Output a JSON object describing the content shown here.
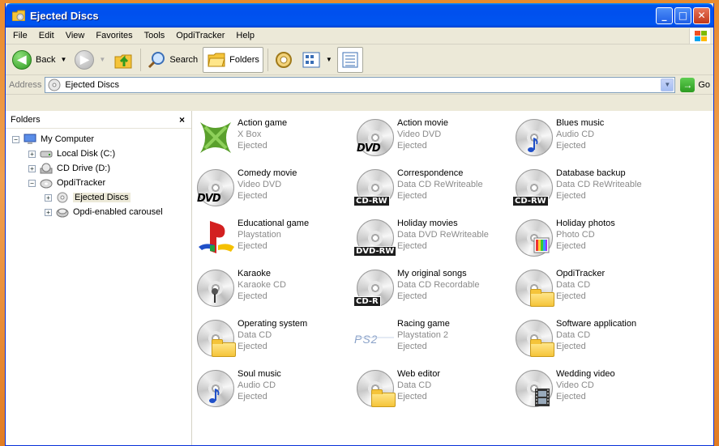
{
  "window": {
    "title": "Ejected Discs"
  },
  "menu": [
    "File",
    "Edit",
    "View",
    "Favorites",
    "Tools",
    "OpdiTracker",
    "Help"
  ],
  "toolbar": {
    "back_label": "Back",
    "search_label": "Search",
    "folders_label": "Folders"
  },
  "address": {
    "label": "Address",
    "value": "Ejected Discs",
    "go_label": "Go"
  },
  "folders_pane": {
    "title": "Folders",
    "close": "×",
    "tree": [
      {
        "label": "My Computer",
        "expander": "−",
        "level": 0,
        "icon": "computer-icon"
      },
      {
        "label": "Local Disk (C:)",
        "expander": "+",
        "level": 1,
        "icon": "hard-disk-icon"
      },
      {
        "label": "CD Drive (D:)",
        "expander": "+",
        "level": 1,
        "icon": "cd-drive-icon"
      },
      {
        "label": "OpdiTracker",
        "expander": "−",
        "level": 1,
        "icon": "disc-tracker-icon"
      },
      {
        "label": "Ejected Discs",
        "expander": "+",
        "level": 2,
        "icon": "ejected-disc-icon",
        "selected": true
      },
      {
        "label": "Opdi-enabled carousel",
        "expander": "+",
        "level": 2,
        "icon": "carousel-icon"
      }
    ]
  },
  "items": [
    {
      "name": "Action game",
      "type": "X Box",
      "status": "Ejected",
      "icon": "xbox-icon"
    },
    {
      "name": "Action movie",
      "type": "Video DVD",
      "status": "Ejected",
      "icon": "dvd-disc-icon",
      "badge": "DVD"
    },
    {
      "name": "Blues music",
      "type": "Audio CD",
      "status": "Ejected",
      "icon": "audio-cd-icon"
    },
    {
      "name": "Comedy movie",
      "type": "Video DVD",
      "status": "Ejected",
      "icon": "dvd-disc-icon",
      "badge": "DVD"
    },
    {
      "name": "Correspondence",
      "type": "Data CD ReWriteable",
      "status": "Ejected",
      "icon": "cd-rw-icon",
      "badge": "CD-RW"
    },
    {
      "name": "Database backup",
      "type": "Data CD ReWriteable",
      "status": "Ejected",
      "icon": "cd-rw-icon",
      "badge": "CD-RW"
    },
    {
      "name": "Educational game",
      "type": "Playstation",
      "status": "Ejected",
      "icon": "playstation-icon"
    },
    {
      "name": "Holiday movies",
      "type": "Data DVD ReWriteable",
      "status": "Ejected",
      "icon": "dvd-rw-icon",
      "badge": "DVD-RW"
    },
    {
      "name": "Holiday photos",
      "type": "Photo CD",
      "status": "Ejected",
      "icon": "photo-cd-icon"
    },
    {
      "name": "Karaoke",
      "type": "Karaoke CD",
      "status": "Ejected",
      "icon": "karaoke-cd-icon"
    },
    {
      "name": "My original songs",
      "type": "Data CD Recordable",
      "status": "Ejected",
      "icon": "cd-r-icon",
      "badge": "CD-R"
    },
    {
      "name": "OpdiTracker",
      "type": "Data CD",
      "status": "Ejected",
      "icon": "data-cd-icon"
    },
    {
      "name": "Operating system",
      "type": "Data CD",
      "status": "Ejected",
      "icon": "data-cd-icon"
    },
    {
      "name": "Racing game",
      "type": "Playstation 2",
      "status": "Ejected",
      "icon": "ps2-icon"
    },
    {
      "name": "Software application",
      "type": "Data CD",
      "status": "Ejected",
      "icon": "data-cd-icon"
    },
    {
      "name": "Soul music",
      "type": "Audio CD",
      "status": "Ejected",
      "icon": "audio-cd-icon"
    },
    {
      "name": "Web editor",
      "type": "Data CD",
      "status": "Ejected",
      "icon": "data-cd-icon"
    },
    {
      "name": "Wedding video",
      "type": "Video CD",
      "status": "Ejected",
      "icon": "video-cd-icon"
    }
  ],
  "colors": {
    "titlebar": "#0053ee",
    "desktop": "#e98b2e",
    "selection": "#ece9d8"
  }
}
